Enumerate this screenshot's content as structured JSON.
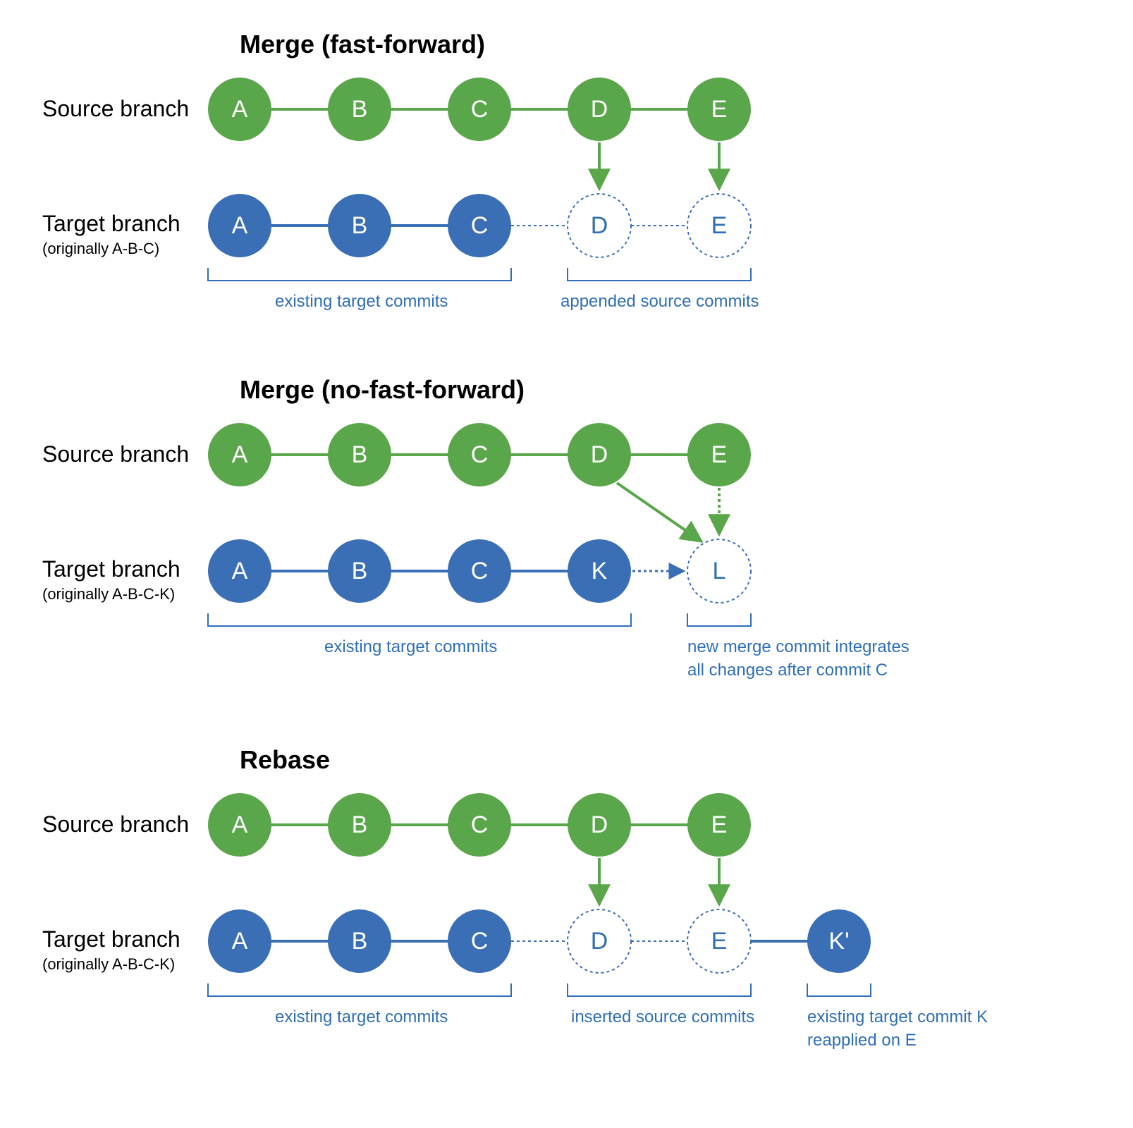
{
  "colors": {
    "green": "#5aa64a",
    "blue": "#3a6eb5",
    "blueText": "#2f6fb5"
  },
  "sections": [
    {
      "title": "Merge (fast-forward)",
      "source_label": "Source branch",
      "target_label": "Target branch",
      "target_sublabel": "(originally A-B-C)",
      "source_nodes": [
        "A",
        "B",
        "C",
        "D",
        "E"
      ],
      "target_nodes_solid": [
        "A",
        "B",
        "C"
      ],
      "target_nodes_dashed": [
        "D",
        "E"
      ],
      "caption_left": "existing target commits",
      "caption_right": "appended source commits"
    },
    {
      "title": "Merge (no-fast-forward)",
      "source_label": "Source branch",
      "target_label": "Target branch",
      "target_sublabel": "(originally A-B-C-K)",
      "source_nodes": [
        "A",
        "B",
        "C",
        "D",
        "E"
      ],
      "target_nodes_solid": [
        "A",
        "B",
        "C",
        "K"
      ],
      "target_nodes_dashed": [
        "L"
      ],
      "caption_left": "existing target commits",
      "caption_right_line1": "new merge commit integrates",
      "caption_right_line2": "all changes after commit C"
    },
    {
      "title": "Rebase",
      "source_label": "Source branch",
      "target_label": "Target branch",
      "target_sublabel": "(originally A-B-C-K)",
      "source_nodes": [
        "A",
        "B",
        "C",
        "D",
        "E"
      ],
      "target_nodes_solid": [
        "A",
        "B",
        "C"
      ],
      "target_nodes_dashed": [
        "D",
        "E"
      ],
      "target_extra_solid": "K'",
      "caption_left": "existing target commits",
      "caption_mid": "inserted source commits",
      "caption_right_line1": "existing target commit K",
      "caption_right_line2": "reapplied on E"
    }
  ]
}
